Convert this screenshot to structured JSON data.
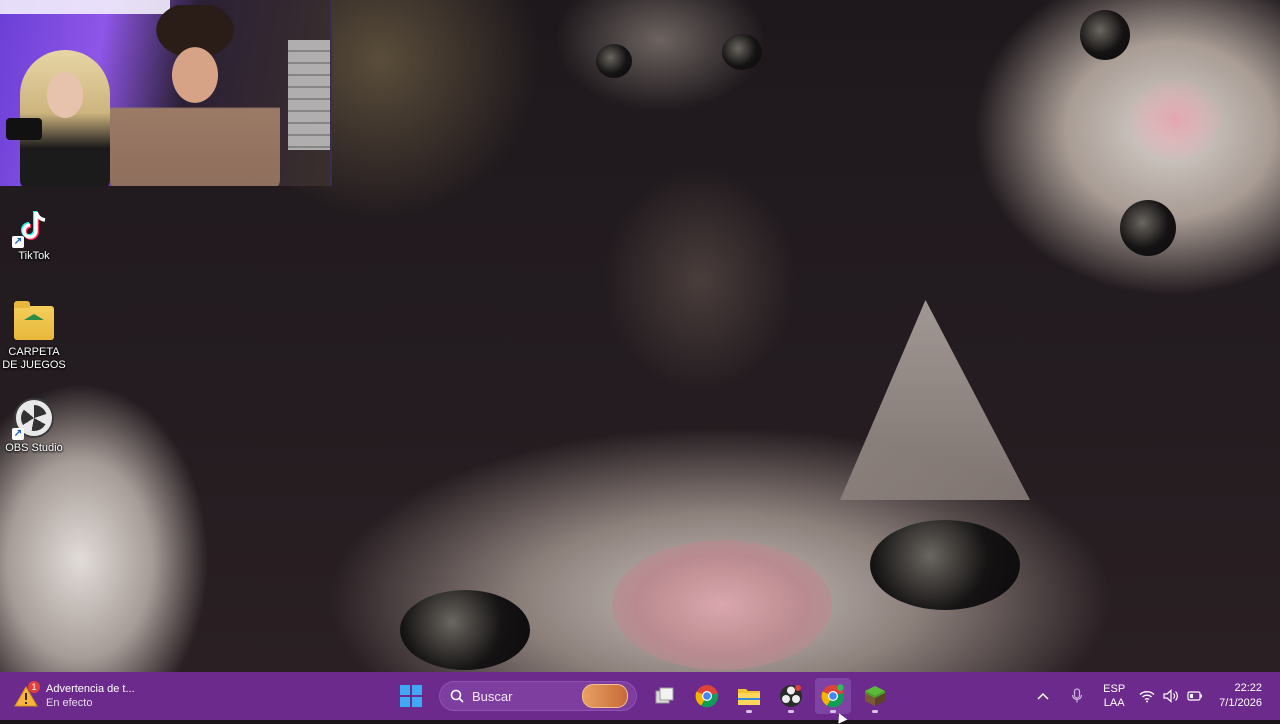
{
  "desktop": {
    "icons": [
      {
        "label": "TikTok",
        "icon": "tiktok-icon"
      },
      {
        "label": "CARPETA DE JUEGOS",
        "icon": "folder-icon"
      },
      {
        "label": "OBS Studio",
        "icon": "obs-icon"
      }
    ]
  },
  "taskbar": {
    "notification": {
      "title": "Advertencia de t...",
      "subtitle": "En efecto",
      "badge": "1"
    },
    "search_placeholder": "Buscar",
    "apps": [
      {
        "name": "start-button",
        "icon": "windows-icon"
      },
      {
        "name": "task-view-button",
        "icon": "task-view-icon"
      },
      {
        "name": "chrome-button",
        "icon": "chrome-icon"
      },
      {
        "name": "file-explorer-button",
        "icon": "folder-icon"
      },
      {
        "name": "obs-button",
        "icon": "obs-icon"
      },
      {
        "name": "chrome-profile-button",
        "icon": "chrome-icon"
      },
      {
        "name": "minecraft-button",
        "icon": "grass-block-icon"
      }
    ],
    "tray": {
      "language": "ESP",
      "layout": "LAA",
      "time": "22:22",
      "date": "7/1/2026"
    }
  },
  "colors": {
    "taskbar": "#6b2a8c",
    "webcam_light": "#8f56e8"
  }
}
